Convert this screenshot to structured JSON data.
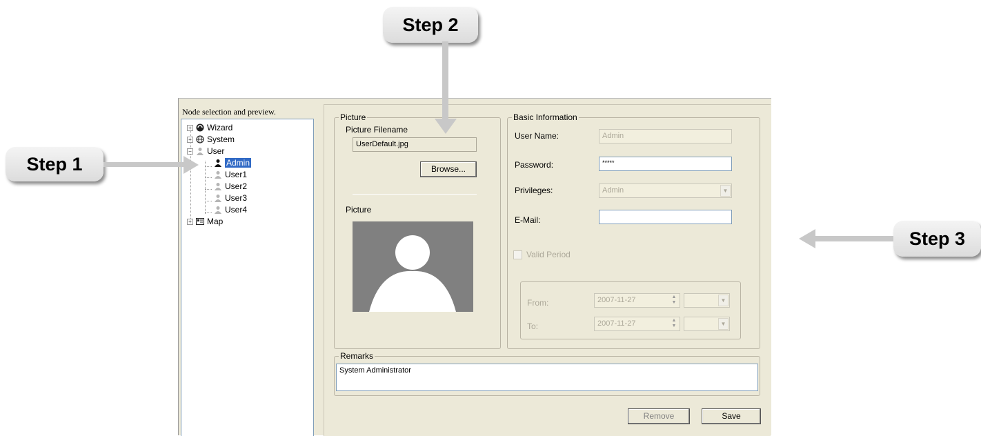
{
  "callouts": {
    "step1": "Step 1",
    "step2": "Step 2",
    "step3": "Step 3"
  },
  "tree_panel": {
    "title": "Node selection and preview.",
    "nodes": [
      {
        "label": "Wizard",
        "icon": "wizard-icon",
        "expander": "+"
      },
      {
        "label": "System",
        "icon": "globe-icon",
        "expander": "+"
      },
      {
        "label": "User",
        "icon": "user-group-icon",
        "expander": "-"
      },
      {
        "label": "Admin",
        "icon": "user-icon",
        "selected": true
      },
      {
        "label": "User1",
        "icon": "user-icon"
      },
      {
        "label": "User2",
        "icon": "user-icon"
      },
      {
        "label": "User3",
        "icon": "user-icon"
      },
      {
        "label": "User4",
        "icon": "user-icon"
      },
      {
        "label": "Map",
        "icon": "map-icon",
        "expander": "+"
      }
    ]
  },
  "picture_group": {
    "legend": "Picture",
    "filename_label": "Picture Filename",
    "filename_value": "UserDefault.jpg",
    "browse_label": "Browse...",
    "preview_label": "Picture"
  },
  "basic_info": {
    "legend": "Basic Information",
    "username_label": "User Name:",
    "username_value": "Admin",
    "password_label": "Password:",
    "password_value": "*****",
    "privileges_label": "Privileges:",
    "privileges_value": "Admin",
    "email_label": "E-Mail:",
    "email_value": "",
    "valid_period_label": "Valid Period",
    "valid_period_checked": false,
    "from_label": "From:",
    "from_date": "2007-11-27",
    "to_label": "To:",
    "to_date": "2007-11-27"
  },
  "remarks": {
    "legend": "Remarks",
    "value": "System Administrator"
  },
  "actions": {
    "remove_label": "Remove",
    "save_label": "Save"
  }
}
